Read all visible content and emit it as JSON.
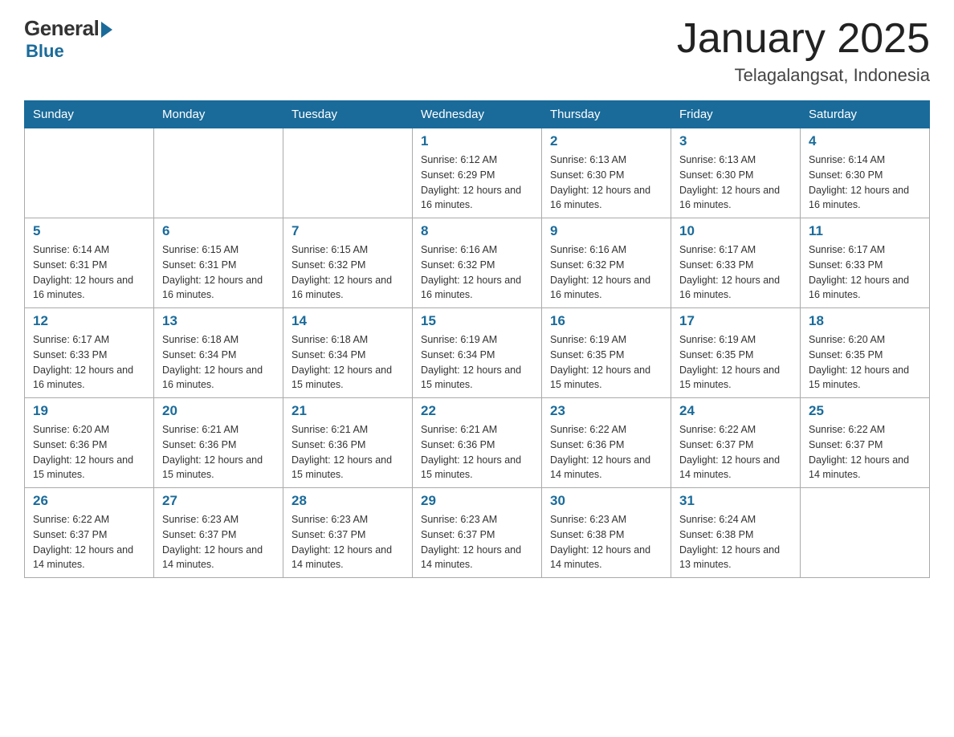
{
  "logo": {
    "general": "General",
    "blue": "Blue"
  },
  "header": {
    "month": "January 2025",
    "location": "Telagalangsat, Indonesia"
  },
  "weekdays": [
    "Sunday",
    "Monday",
    "Tuesday",
    "Wednesday",
    "Thursday",
    "Friday",
    "Saturday"
  ],
  "weeks": [
    [
      {
        "day": "",
        "info": ""
      },
      {
        "day": "",
        "info": ""
      },
      {
        "day": "",
        "info": ""
      },
      {
        "day": "1",
        "info": "Sunrise: 6:12 AM\nSunset: 6:29 PM\nDaylight: 12 hours\nand 16 minutes."
      },
      {
        "day": "2",
        "info": "Sunrise: 6:13 AM\nSunset: 6:30 PM\nDaylight: 12 hours\nand 16 minutes."
      },
      {
        "day": "3",
        "info": "Sunrise: 6:13 AM\nSunset: 6:30 PM\nDaylight: 12 hours\nand 16 minutes."
      },
      {
        "day": "4",
        "info": "Sunrise: 6:14 AM\nSunset: 6:30 PM\nDaylight: 12 hours\nand 16 minutes."
      }
    ],
    [
      {
        "day": "5",
        "info": "Sunrise: 6:14 AM\nSunset: 6:31 PM\nDaylight: 12 hours\nand 16 minutes."
      },
      {
        "day": "6",
        "info": "Sunrise: 6:15 AM\nSunset: 6:31 PM\nDaylight: 12 hours\nand 16 minutes."
      },
      {
        "day": "7",
        "info": "Sunrise: 6:15 AM\nSunset: 6:32 PM\nDaylight: 12 hours\nand 16 minutes."
      },
      {
        "day": "8",
        "info": "Sunrise: 6:16 AM\nSunset: 6:32 PM\nDaylight: 12 hours\nand 16 minutes."
      },
      {
        "day": "9",
        "info": "Sunrise: 6:16 AM\nSunset: 6:32 PM\nDaylight: 12 hours\nand 16 minutes."
      },
      {
        "day": "10",
        "info": "Sunrise: 6:17 AM\nSunset: 6:33 PM\nDaylight: 12 hours\nand 16 minutes."
      },
      {
        "day": "11",
        "info": "Sunrise: 6:17 AM\nSunset: 6:33 PM\nDaylight: 12 hours\nand 16 minutes."
      }
    ],
    [
      {
        "day": "12",
        "info": "Sunrise: 6:17 AM\nSunset: 6:33 PM\nDaylight: 12 hours\nand 16 minutes."
      },
      {
        "day": "13",
        "info": "Sunrise: 6:18 AM\nSunset: 6:34 PM\nDaylight: 12 hours\nand 16 minutes."
      },
      {
        "day": "14",
        "info": "Sunrise: 6:18 AM\nSunset: 6:34 PM\nDaylight: 12 hours\nand 15 minutes."
      },
      {
        "day": "15",
        "info": "Sunrise: 6:19 AM\nSunset: 6:34 PM\nDaylight: 12 hours\nand 15 minutes."
      },
      {
        "day": "16",
        "info": "Sunrise: 6:19 AM\nSunset: 6:35 PM\nDaylight: 12 hours\nand 15 minutes."
      },
      {
        "day": "17",
        "info": "Sunrise: 6:19 AM\nSunset: 6:35 PM\nDaylight: 12 hours\nand 15 minutes."
      },
      {
        "day": "18",
        "info": "Sunrise: 6:20 AM\nSunset: 6:35 PM\nDaylight: 12 hours\nand 15 minutes."
      }
    ],
    [
      {
        "day": "19",
        "info": "Sunrise: 6:20 AM\nSunset: 6:36 PM\nDaylight: 12 hours\nand 15 minutes."
      },
      {
        "day": "20",
        "info": "Sunrise: 6:21 AM\nSunset: 6:36 PM\nDaylight: 12 hours\nand 15 minutes."
      },
      {
        "day": "21",
        "info": "Sunrise: 6:21 AM\nSunset: 6:36 PM\nDaylight: 12 hours\nand 15 minutes."
      },
      {
        "day": "22",
        "info": "Sunrise: 6:21 AM\nSunset: 6:36 PM\nDaylight: 12 hours\nand 15 minutes."
      },
      {
        "day": "23",
        "info": "Sunrise: 6:22 AM\nSunset: 6:36 PM\nDaylight: 12 hours\nand 14 minutes."
      },
      {
        "day": "24",
        "info": "Sunrise: 6:22 AM\nSunset: 6:37 PM\nDaylight: 12 hours\nand 14 minutes."
      },
      {
        "day": "25",
        "info": "Sunrise: 6:22 AM\nSunset: 6:37 PM\nDaylight: 12 hours\nand 14 minutes."
      }
    ],
    [
      {
        "day": "26",
        "info": "Sunrise: 6:22 AM\nSunset: 6:37 PM\nDaylight: 12 hours\nand 14 minutes."
      },
      {
        "day": "27",
        "info": "Sunrise: 6:23 AM\nSunset: 6:37 PM\nDaylight: 12 hours\nand 14 minutes."
      },
      {
        "day": "28",
        "info": "Sunrise: 6:23 AM\nSunset: 6:37 PM\nDaylight: 12 hours\nand 14 minutes."
      },
      {
        "day": "29",
        "info": "Sunrise: 6:23 AM\nSunset: 6:37 PM\nDaylight: 12 hours\nand 14 minutes."
      },
      {
        "day": "30",
        "info": "Sunrise: 6:23 AM\nSunset: 6:38 PM\nDaylight: 12 hours\nand 14 minutes."
      },
      {
        "day": "31",
        "info": "Sunrise: 6:24 AM\nSunset: 6:38 PM\nDaylight: 12 hours\nand 13 minutes."
      },
      {
        "day": "",
        "info": ""
      }
    ]
  ]
}
